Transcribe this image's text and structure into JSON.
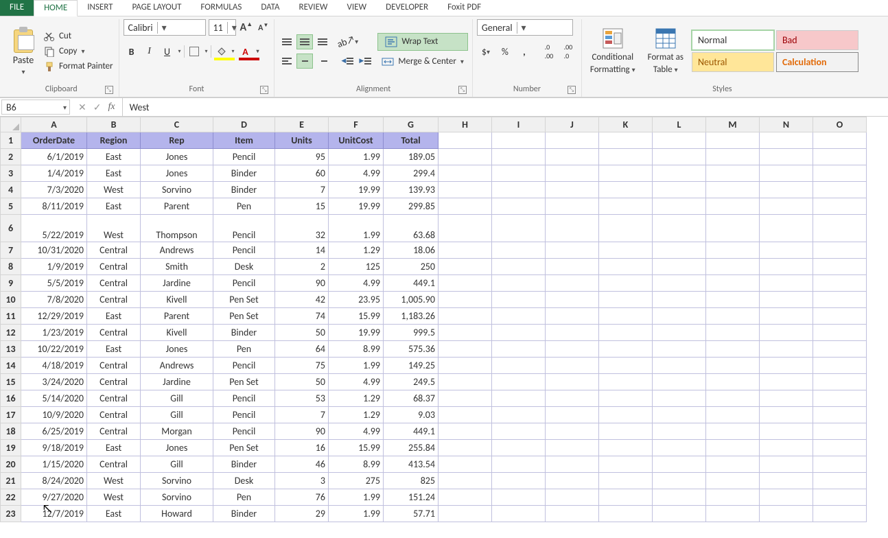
{
  "tabs": [
    "FILE",
    "HOME",
    "INSERT",
    "PAGE LAYOUT",
    "FORMULAS",
    "DATA",
    "REVIEW",
    "VIEW",
    "DEVELOPER",
    "Foxit PDF"
  ],
  "active_tab": "HOME",
  "clipboard": {
    "paste": "Paste",
    "cut": "Cut",
    "copy": "Copy",
    "format_painter": "Format Painter",
    "group": "Clipboard"
  },
  "font": {
    "name": "Calibri",
    "size": "11",
    "group": "Font"
  },
  "alignment": {
    "wrap": "Wrap Text",
    "merge": "Merge & Center",
    "group": "Alignment"
  },
  "number": {
    "format": "General",
    "group": "Number"
  },
  "styles": {
    "cond": "Conditional",
    "cond2": "Formatting",
    "fmt": "Format as",
    "fmt2": "Table",
    "normal": "Normal",
    "bad": "Bad",
    "neutral": "Neutral",
    "calc": "Calculation",
    "group": "Styles"
  },
  "namebox": "B6",
  "formula": "West",
  "col_headers": [
    "A",
    "B",
    "C",
    "D",
    "E",
    "F",
    "G",
    "H",
    "I",
    "J",
    "K",
    "L",
    "M",
    "N",
    "O"
  ],
  "table_headers": [
    "OrderDate",
    "Region",
    "Rep",
    "Item",
    "Units",
    "UnitCost",
    "Total"
  ],
  "rows": [
    [
      "6/1/2019",
      "East",
      "Jones",
      "Pencil",
      "95",
      "1.99",
      "189.05"
    ],
    [
      "1/4/2019",
      "East",
      "Jones",
      "Binder",
      "60",
      "4.99",
      "299.4"
    ],
    [
      "7/3/2020",
      "West",
      "Sorvino",
      "Binder",
      "7",
      "19.99",
      "139.93"
    ],
    [
      "8/11/2019",
      "East",
      "Parent",
      "Pen",
      "15",
      "19.99",
      "299.85"
    ],
    [
      "5/22/2019",
      "West",
      "Thompson",
      "Pencil",
      "32",
      "1.99",
      "63.68"
    ],
    [
      "10/31/2020",
      "Central",
      "Andrews",
      "Pencil",
      "14",
      "1.29",
      "18.06"
    ],
    [
      "1/9/2019",
      "Central",
      "Smith",
      "Desk",
      "2",
      "125",
      "250"
    ],
    [
      "5/5/2019",
      "Central",
      "Jardine",
      "Pencil",
      "90",
      "4.99",
      "449.1"
    ],
    [
      "7/8/2020",
      "Central",
      "Kivell",
      "Pen Set",
      "42",
      "23.95",
      "1,005.90"
    ],
    [
      "12/29/2019",
      "East",
      "Parent",
      "Pen Set",
      "74",
      "15.99",
      "1,183.26"
    ],
    [
      "1/23/2019",
      "Central",
      "Kivell",
      "Binder",
      "50",
      "19.99",
      "999.5"
    ],
    [
      "10/22/2019",
      "East",
      "Jones",
      "Pen",
      "64",
      "8.99",
      "575.36"
    ],
    [
      "4/18/2019",
      "Central",
      "Andrews",
      "Pencil",
      "75",
      "1.99",
      "149.25"
    ],
    [
      "3/24/2020",
      "Central",
      "Jardine",
      "Pen Set",
      "50",
      "4.99",
      "249.5"
    ],
    [
      "5/14/2020",
      "Central",
      "Gill",
      "Pencil",
      "53",
      "1.29",
      "68.37"
    ],
    [
      "10/9/2020",
      "Central",
      "Gill",
      "Pencil",
      "7",
      "1.29",
      "9.03"
    ],
    [
      "6/25/2019",
      "Central",
      "Morgan",
      "Pencil",
      "90",
      "4.99",
      "449.1"
    ],
    [
      "9/18/2019",
      "East",
      "Jones",
      "Pen Set",
      "16",
      "15.99",
      "255.84"
    ],
    [
      "1/15/2020",
      "Central",
      "Gill",
      "Binder",
      "46",
      "8.99",
      "413.54"
    ],
    [
      "8/24/2020",
      "West",
      "Sorvino",
      "Desk",
      "3",
      "275",
      "825"
    ],
    [
      "9/27/2020",
      "West",
      "Sorvino",
      "Pen",
      "76",
      "1.99",
      "151.24"
    ],
    [
      "12/7/2019",
      "East",
      "Howard",
      "Binder",
      "29",
      "1.99",
      "57.71"
    ]
  ]
}
